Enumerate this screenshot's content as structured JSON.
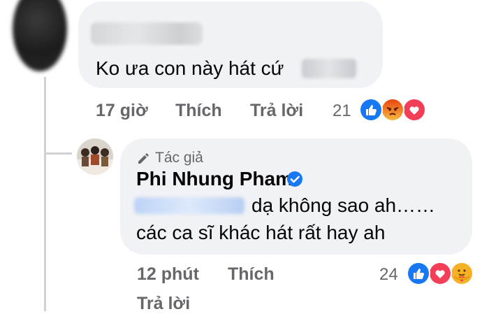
{
  "comment1": {
    "text_visible": "Ko ưa con này hát cứ",
    "time": "17 giờ",
    "like_label": "Thích",
    "reply_label": "Trả lời",
    "reaction_count": "21",
    "reactions": [
      "like-icon",
      "angry-icon",
      "love-icon"
    ]
  },
  "comment2": {
    "author_badge": "Tác giả",
    "author_name": "Phi Nhung Pham",
    "line1_text": "dạ không sao ah……",
    "line2_text": "các ca sĩ khác hát rất hay ah",
    "time": "12 phút",
    "like_label": "Thích",
    "reply_label": "Trả lời",
    "reaction_count": "24",
    "reactions": [
      "like-icon",
      "love-icon",
      "care-icon"
    ]
  },
  "colors": {
    "bubble": "#f0f2f5",
    "meta_text": "#65676b",
    "like_blue": "#1877f2",
    "love_red": "#f33e58",
    "angry_orange": "#e9710f",
    "care_yellow": "#f7b125"
  }
}
